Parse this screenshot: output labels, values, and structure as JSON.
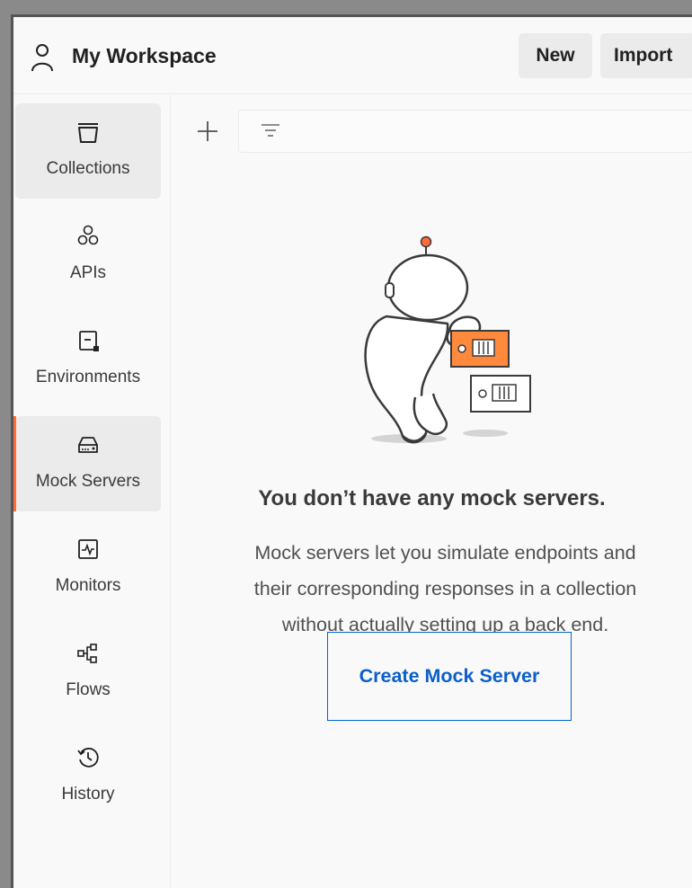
{
  "header": {
    "workspace_title": "My Workspace",
    "new_label": "New",
    "import_label": "Import"
  },
  "sidebar": {
    "items": [
      {
        "label": "Collections",
        "icon": "collections-icon",
        "active": true
      },
      {
        "label": "APIs",
        "icon": "apis-icon",
        "active": false
      },
      {
        "label": "Environments",
        "icon": "environments-icon",
        "active": false
      },
      {
        "label": "Mock Servers",
        "icon": "mock-servers-icon",
        "active": true,
        "selected": true
      },
      {
        "label": "Monitors",
        "icon": "monitors-icon",
        "active": false
      },
      {
        "label": "Flows",
        "icon": "flows-icon",
        "active": false
      },
      {
        "label": "History",
        "icon": "history-icon",
        "active": false
      }
    ]
  },
  "main": {
    "empty_title": "You don’t have any mock servers.",
    "empty_description_lines": [
      "Mock servers let you simulate endpoints and",
      "their corresponding responses in a collection",
      "without actually setting up a back end."
    ],
    "create_button_label": "Create Mock Server"
  },
  "colors": {
    "accent": "#ff6c37",
    "link_blue": "#0b5fc9",
    "active_bg": "#ebebeb"
  }
}
